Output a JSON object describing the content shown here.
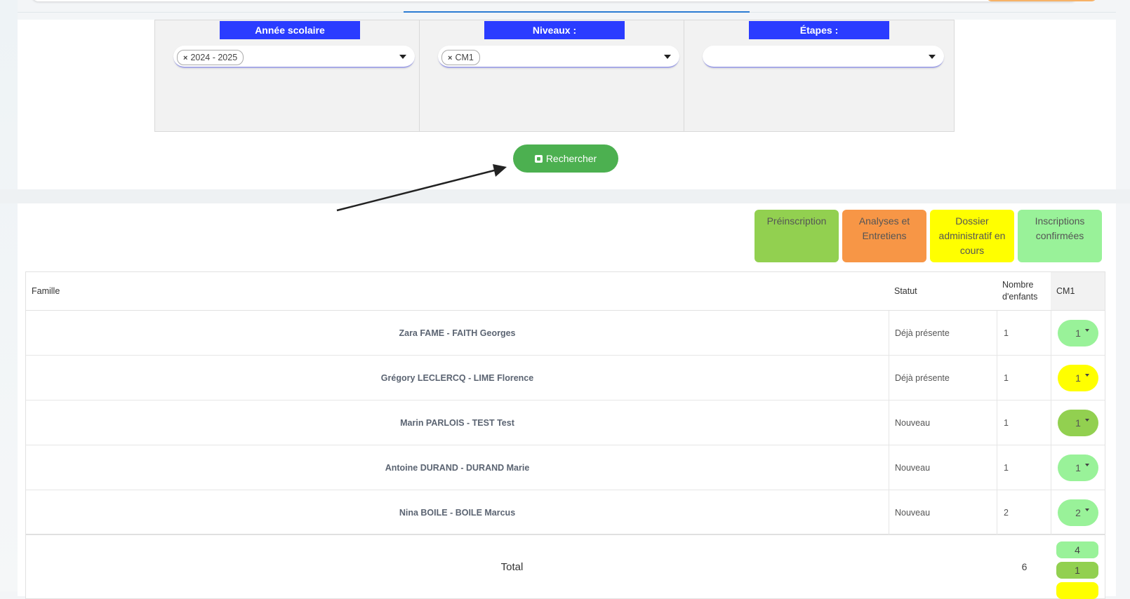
{
  "filters": {
    "annee": {
      "title": "Année scolaire",
      "chip": "2024 - 2025"
    },
    "niveaux": {
      "title": "Niveaux :",
      "chip": "CM1"
    },
    "etapes": {
      "title": "Étapes :",
      "chip": ""
    }
  },
  "search_button": {
    "label": "Rechercher"
  },
  "legend": [
    {
      "label": "Préinscription",
      "color": "#92d050"
    },
    {
      "label": "Analyses et Entretiens",
      "color": "#f79646"
    },
    {
      "label": "Dossier administratif en cours",
      "color": "#ffff00"
    },
    {
      "label": "Inscriptions confirmées",
      "color": "#99f299"
    }
  ],
  "table": {
    "headers": {
      "famille": "Famille",
      "statut": "Statut",
      "nombre": "Nombre d'enfants",
      "cm1": "CM1"
    },
    "rows": [
      {
        "famille": "Zara FAME - FAITH Georges",
        "statut": "Déjà présente",
        "nombre": "1",
        "cm1": "1",
        "color": "#99f299"
      },
      {
        "famille": "Grégory LECLERCQ - LIME Florence",
        "statut": "Déjà présente",
        "nombre": "1",
        "cm1": "1",
        "color": "#ffff00"
      },
      {
        "famille": "Marin PARLOIS - TEST Test",
        "statut": "Nouveau",
        "nombre": "1",
        "cm1": "1",
        "color": "#92d050"
      },
      {
        "famille": "Antoine DURAND - DURAND Marie",
        "statut": "Nouveau",
        "nombre": "1",
        "cm1": "1",
        "color": "#99f299"
      },
      {
        "famille": "Nina BOILE - BOILE Marcus",
        "statut": "Nouveau",
        "nombre": "2",
        "cm1": "2",
        "color": "#99f299"
      }
    ],
    "total": {
      "label": "Total",
      "nombre": "6",
      "cm1_breakdown": [
        {
          "value": "4",
          "color": "#99f299"
        },
        {
          "value": "1",
          "color": "#92d050"
        },
        {
          "value": "",
          "color": "#ffff00"
        }
      ]
    }
  }
}
